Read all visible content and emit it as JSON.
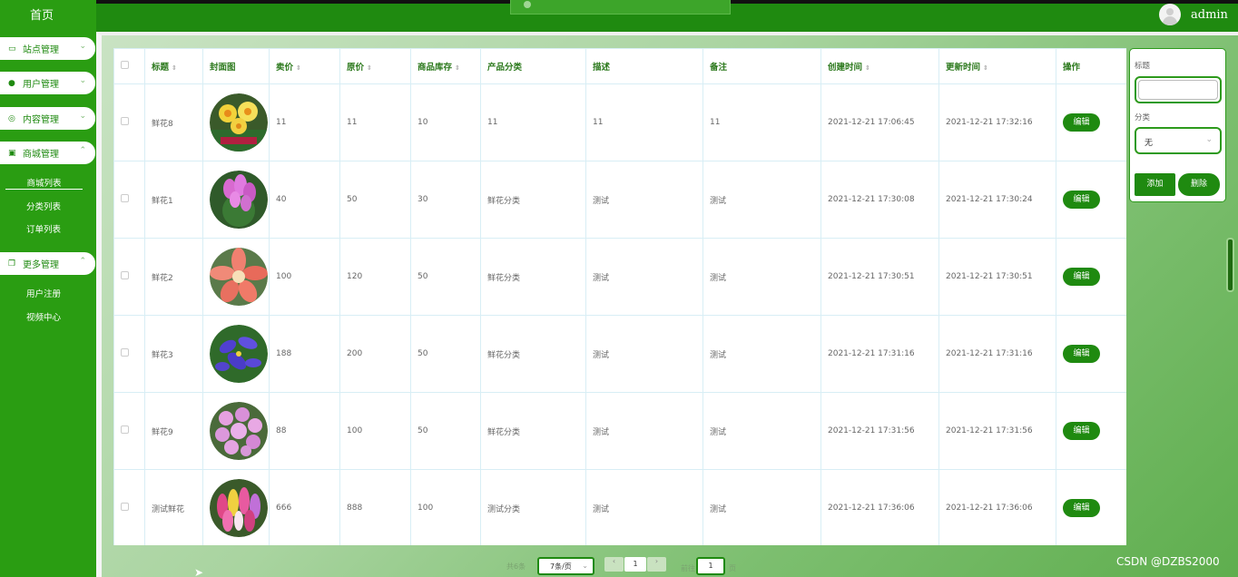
{
  "sidebar": {
    "home": "首页",
    "menus": [
      {
        "label": "站点管理",
        "icon": "monitor-icon"
      },
      {
        "label": "用户管理",
        "icon": "user-icon"
      },
      {
        "label": "内容管理",
        "icon": "chat-icon"
      },
      {
        "label": "商城管理",
        "icon": "bag-icon"
      },
      {
        "label": "更多管理",
        "icon": "copy-icon"
      }
    ],
    "mall_items": [
      "商城列表",
      "分类列表",
      "订单列表"
    ],
    "more_items": [
      "用户注册",
      "视频中心"
    ]
  },
  "header": {
    "username": "admin"
  },
  "table": {
    "headers": [
      "标题",
      "封面图",
      "卖价",
      "原价",
      "商品库存",
      "产品分类",
      "描述",
      "备注",
      "创建时间",
      "更新时间",
      "操作"
    ],
    "rows": [
      {
        "title": "鲜花8",
        "image": "daffodil",
        "sell": "11",
        "orig": "11",
        "stock": "10",
        "category": "11",
        "desc": "11",
        "note": "11",
        "created": "2021-12-21 17:06:45",
        "updated": "2021-12-21 17:32:16"
      },
      {
        "title": "鲜花1",
        "image": "cyclamen",
        "sell": "40",
        "orig": "50",
        "stock": "30",
        "category": "鲜花分类",
        "desc": "测试",
        "note": "测试",
        "created": "2021-12-21 17:30:08",
        "updated": "2021-12-21 17:30:24"
      },
      {
        "title": "鲜花2",
        "image": "amaryllis",
        "sell": "100",
        "orig": "120",
        "stock": "50",
        "category": "鲜花分类",
        "desc": "测试",
        "note": "测试",
        "created": "2021-12-21 17:30:51",
        "updated": "2021-12-21 17:30:51"
      },
      {
        "title": "鲜花3",
        "image": "iris",
        "sell": "188",
        "orig": "200",
        "stock": "50",
        "category": "鲜花分类",
        "desc": "测试",
        "note": "测试",
        "created": "2021-12-21 17:31:16",
        "updated": "2021-12-21 17:31:16"
      },
      {
        "title": "鲜花9",
        "image": "pink-flowers",
        "sell": "88",
        "orig": "100",
        "stock": "50",
        "category": "鲜花分类",
        "desc": "测试",
        "note": "测试",
        "created": "2021-12-21 17:31:56",
        "updated": "2021-12-21 17:31:56"
      },
      {
        "title": "测试鲜花",
        "image": "hyacinth",
        "sell": "666",
        "orig": "888",
        "stock": "100",
        "category": "测试分类",
        "desc": "测试",
        "note": "测试",
        "created": "2021-12-21 17:36:06",
        "updated": "2021-12-21 17:36:06"
      }
    ],
    "edit_label": "编辑"
  },
  "form": {
    "title_label": "标题",
    "title_value": "",
    "category_label": "分类",
    "category_value": "无",
    "add_label": "添加",
    "delete_label": "删除"
  },
  "pagination": {
    "total": "共6条",
    "page_size": "7条/页",
    "current_page": "1",
    "goto_prefix": "前往",
    "goto_value": "1",
    "goto_suffix": "页"
  },
  "watermark": "CSDN @DZBS2000",
  "colors": {
    "primary": "#1f8a10",
    "sidebar": "#2a9d12"
  }
}
